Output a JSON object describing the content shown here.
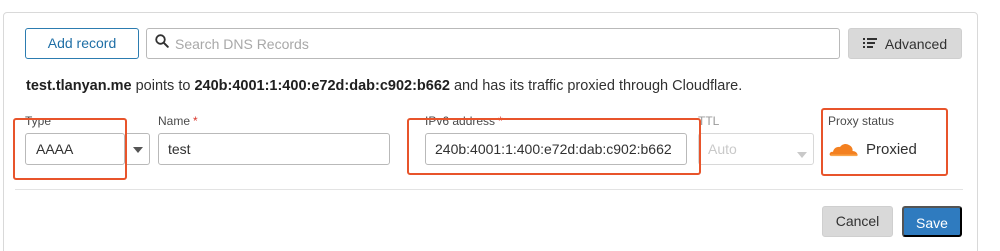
{
  "toolbar": {
    "add_record_label": "Add record",
    "search_placeholder": "Search DNS Records",
    "advanced_label": "Advanced",
    "search_icon": "search-icon",
    "advanced_icon": "list-icon"
  },
  "summary": {
    "host": "test.tlanyan.me",
    "text1": " points to ",
    "address": "240b:4001:1:400:e72d:dab:c902:b662",
    "text2": " and has its traffic proxied through Cloudflare."
  },
  "form": {
    "type": {
      "label": "Type",
      "value": "AAAA"
    },
    "name": {
      "label": "Name",
      "required_mark": "*",
      "value": "test"
    },
    "ipv6": {
      "label": "IPv6 address",
      "required_mark": "*",
      "value": "240b:4001:1:400:e72d:dab:c902:b662"
    },
    "ttl": {
      "label": "TTL",
      "value": "Auto"
    },
    "proxy": {
      "label": "Proxy status",
      "value": "Proxied",
      "icon": "cloud-icon"
    }
  },
  "actions": {
    "cancel_label": "Cancel",
    "save_label": "Save"
  },
  "colors": {
    "highlight": "#e8542b",
    "primary": "#2f7bbf",
    "cloud": "#f38020"
  }
}
